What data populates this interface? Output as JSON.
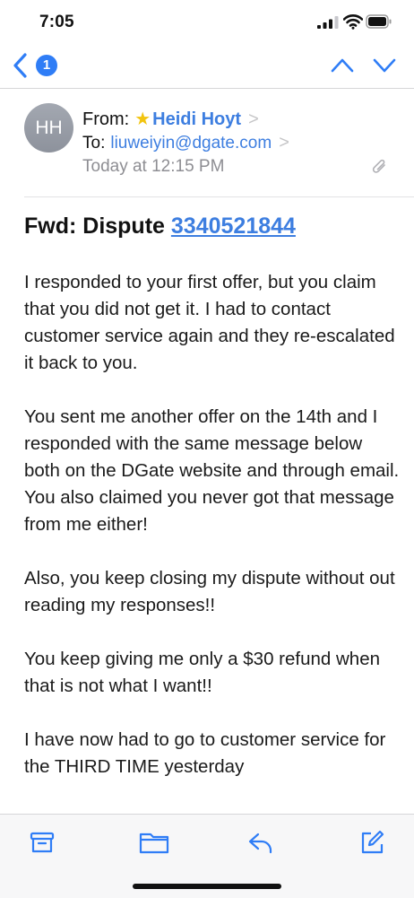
{
  "status_bar": {
    "time": "7:05"
  },
  "nav": {
    "unread_count": "1"
  },
  "header": {
    "avatar_initials": "HH",
    "from_label": "From:",
    "sender_name": "Heidi Hoyt",
    "to_label": "To:",
    "recipient": "liuweiyin@dgate.com",
    "date": "Today at 12:15 PM"
  },
  "email": {
    "subject_prefix": "Fwd: Dispute ",
    "subject_number": "3340521844",
    "paragraphs": [
      "I responded to your first offer, but you claim that you did not get it. I had to contact customer service again and they re-escalated it back to you.",
      "You sent me another offer on the 14th and I responded with the same message below both on the DGate website and through email. You also claimed you never got that message from me either!",
      "Also, you keep closing my dispute without out reading my responses!!",
      "You keep giving me only a $30 refund when that is not what I want!!",
      "I have now had to go to customer service for the THIRD TIME  yesterday"
    ]
  },
  "toolbar": {
    "icons": [
      "archive-icon",
      "folder-icon",
      "reply-icon",
      "compose-icon"
    ]
  },
  "colors": {
    "accent": "#3d7ee0",
    "badge": "#2f7df6",
    "star": "#f2c40f"
  }
}
